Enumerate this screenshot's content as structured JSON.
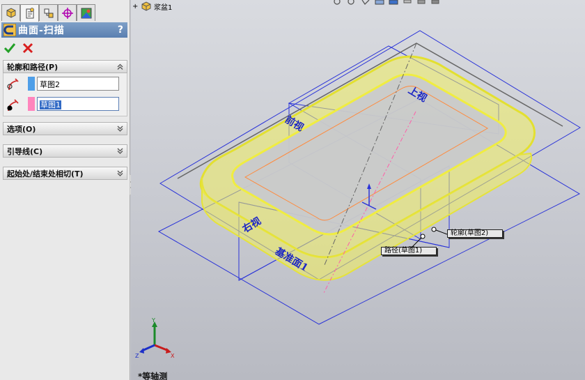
{
  "window": {
    "feature_title": "曲面-扫描",
    "help_label": "?",
    "tabs": [
      "feature-manager",
      "property-manager",
      "configuration-manager",
      "dimxpert-manager",
      "display-manager"
    ]
  },
  "groups": {
    "profile_path": {
      "label": "轮廓和路径(P)",
      "profile_value": "草图2",
      "path_value": "草图1"
    },
    "options": {
      "label": "选项(O)"
    },
    "guides": {
      "label": "引导线(C)"
    },
    "tangency": {
      "label": "起始处/结束处相切(T)"
    }
  },
  "tree": {
    "expand": "+",
    "part_name": "浆盆1"
  },
  "graphics": {
    "planes": {
      "front": "前视",
      "top": "上视",
      "right": "右视",
      "base": "基准面1"
    },
    "callouts": {
      "profile": "轮廓(草图2)",
      "path": "路径(草图1)"
    },
    "view_name": "*等轴测",
    "triad_axes": {
      "x": "X",
      "y": "Y",
      "z": "Z"
    }
  },
  "colors": {
    "profile_swatch": "#4f9fe8",
    "path_swatch": "#ff85bd",
    "plane_blue": "#1c26c4",
    "surface_yellow": "#f2f062",
    "sketch_pink": "#ff5fa8"
  }
}
